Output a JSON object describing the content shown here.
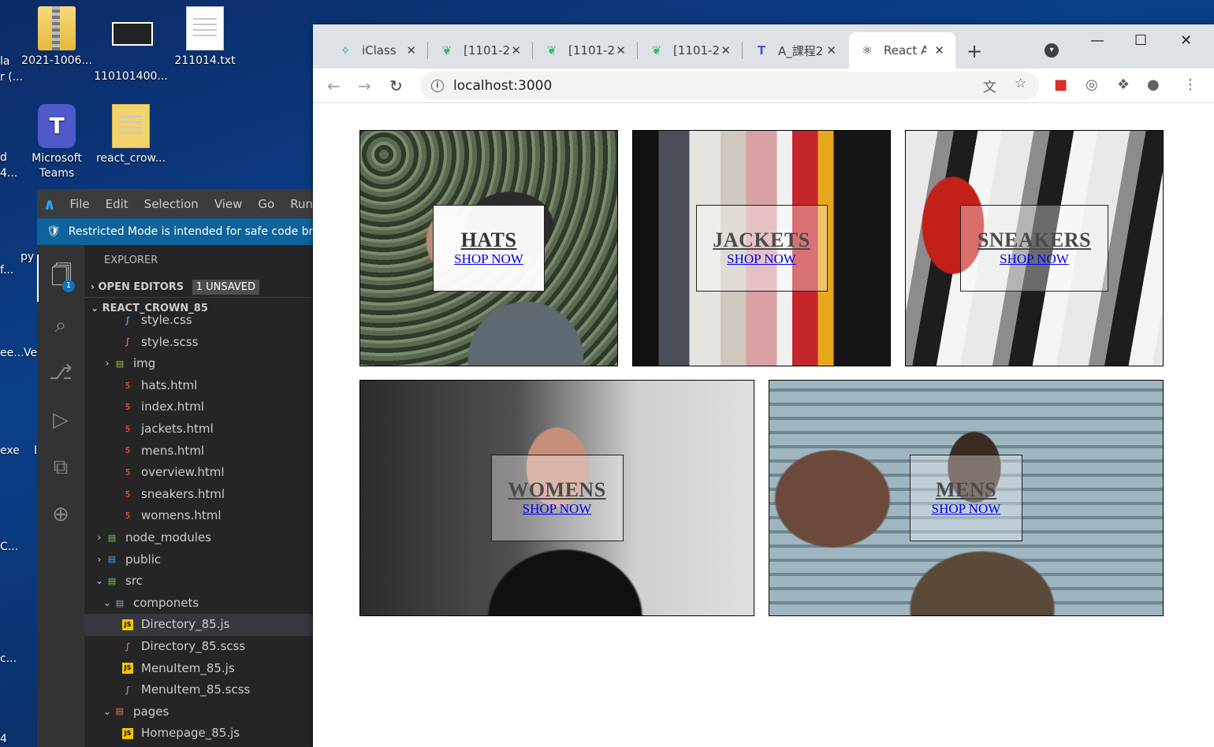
{
  "desktop": {
    "icons": [
      {
        "label": "2021-1006...",
        "kind": "zip"
      },
      {
        "label": "110101400...",
        "kind": "image"
      },
      {
        "label": "211014.txt",
        "kind": "txt"
      },
      {
        "label": "Microsoft Teams",
        "kind": "teams"
      },
      {
        "label": "react_crow...",
        "kind": "folder"
      }
    ],
    "partial_labels": [
      "la",
      "r (...",
      "d",
      "4...",
      "py",
      "f...",
      "ee...",
      "Ve",
      "exe",
      "I",
      "C...",
      "c...",
      "4"
    ]
  },
  "vscode": {
    "menu": [
      "File",
      "Edit",
      "Selection",
      "View",
      "Go",
      "Run"
    ],
    "banner": "Restricted Mode is intended for safe code browsing",
    "explorer_title": "EXPLORER",
    "explorer_badge": "1",
    "open_editors": "OPEN EDITORS",
    "unsaved": "1 UNSAVED",
    "project": "REACT_CROWN_85",
    "tree": [
      {
        "label": "style.css",
        "icon": "css",
        "indent": 2
      },
      {
        "label": "style.scss",
        "icon": "scss",
        "indent": 2
      },
      {
        "label": "img",
        "icon": "folder-green",
        "indent": 1,
        "chevron": "right"
      },
      {
        "label": "hats.html",
        "icon": "html",
        "indent": 2
      },
      {
        "label": "index.html",
        "icon": "html",
        "indent": 2
      },
      {
        "label": "jackets.html",
        "icon": "html",
        "indent": 2
      },
      {
        "label": "mens.html",
        "icon": "html",
        "indent": 2
      },
      {
        "label": "overview.html",
        "icon": "html",
        "indent": 2
      },
      {
        "label": "sneakers.html",
        "icon": "html",
        "indent": 2
      },
      {
        "label": "womens.html",
        "icon": "html",
        "indent": 2
      },
      {
        "label": "node_modules",
        "icon": "folder-green",
        "indent": 0,
        "chevron": "right"
      },
      {
        "label": "public",
        "icon": "folder-blue",
        "indent": 0,
        "chevron": "right"
      },
      {
        "label": "src",
        "icon": "folder-green",
        "indent": 0,
        "chevron": "down"
      },
      {
        "label": "componets",
        "icon": "folder",
        "indent": 1,
        "chevron": "down"
      },
      {
        "label": "Directory_85.js",
        "icon": "js",
        "indent": 2,
        "selected": true
      },
      {
        "label": "Directory_85.scss",
        "icon": "scss",
        "indent": 2
      },
      {
        "label": "MenuItem_85.js",
        "icon": "js",
        "indent": 2
      },
      {
        "label": "MenuItem_85.scss",
        "icon": "scss",
        "indent": 2
      },
      {
        "label": "pages",
        "icon": "folder-red",
        "indent": 1,
        "chevron": "down"
      },
      {
        "label": "Homepage_85.js",
        "icon": "js",
        "indent": 2
      }
    ]
  },
  "browser": {
    "tabs": [
      {
        "label": "iClass",
        "icon": "iclass-icon"
      },
      {
        "label": "[1101-2",
        "icon": "evernote-icon"
      },
      {
        "label": "[1101-2",
        "icon": "evernote-icon"
      },
      {
        "label": "[1101-2",
        "icon": "evernote-icon"
      },
      {
        "label": "A_課程2",
        "icon": "teams-icon"
      },
      {
        "label": "React A",
        "icon": "react-icon",
        "active": true
      }
    ],
    "new_tab": "+",
    "url": "localhost:3000"
  },
  "page": {
    "menu_items": [
      {
        "title": "HATS",
        "subtitle": "SHOP NOW"
      },
      {
        "title": "JACKETS",
        "subtitle": "SHOP NOW"
      },
      {
        "title": "SNEAKERS",
        "subtitle": "SHOP NOW"
      },
      {
        "title": "WOMENS",
        "subtitle": "SHOP NOW"
      },
      {
        "title": "MENS",
        "subtitle": "SHOP NOW"
      }
    ]
  },
  "colors": {
    "vscode_banner": "#0e639c",
    "vscode_sidebar": "#252526",
    "link": "#0000ee",
    "chrome_tabstrip": "#dee1e6"
  }
}
